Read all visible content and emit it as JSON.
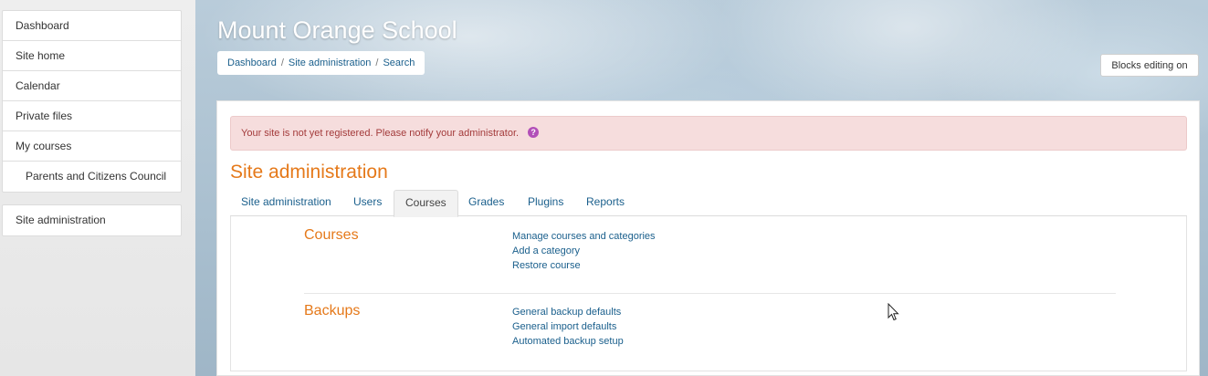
{
  "nav": {
    "primary": [
      {
        "label": "Dashboard"
      },
      {
        "label": "Site home"
      },
      {
        "label": "Calendar"
      },
      {
        "label": "Private files"
      },
      {
        "label": "My courses"
      },
      {
        "label": "Parents and Citizens Council"
      }
    ],
    "secondary": [
      {
        "label": "Site administration"
      }
    ]
  },
  "header": {
    "site_title": "Mount Orange School",
    "breadcrumb": [
      "Dashboard",
      "Site administration",
      "Search"
    ],
    "breadcrumb_sep": "/",
    "blocks_editing_label": "Blocks editing on"
  },
  "alert": {
    "text": "Your site is not yet registered. Please notify your administrator.",
    "help_glyph": "?",
    "color": "#a33b3b"
  },
  "page": {
    "heading": "Site administration",
    "accent": "#e5791a",
    "link_color": "#1a5f8c"
  },
  "tabs": [
    {
      "label": "Site administration",
      "active": false
    },
    {
      "label": "Users",
      "active": false
    },
    {
      "label": "Courses",
      "active": true
    },
    {
      "label": "Grades",
      "active": false
    },
    {
      "label": "Plugins",
      "active": false
    },
    {
      "label": "Reports",
      "active": false
    }
  ],
  "sections": [
    {
      "title": "Courses",
      "links": [
        "Manage courses and categories",
        "Add a category",
        "Restore course"
      ]
    },
    {
      "title": "Backups",
      "links": [
        "General backup defaults",
        "General import defaults",
        "Automated backup setup"
      ]
    }
  ]
}
